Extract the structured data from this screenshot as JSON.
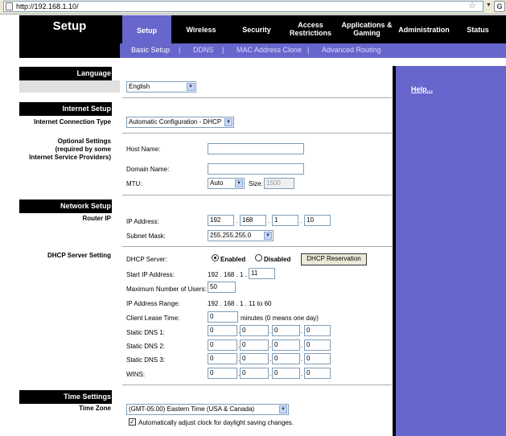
{
  "browser": {
    "url": "http://192.168.1.10/"
  },
  "header": {
    "title": "Setup",
    "tabs": [
      {
        "label": "Setup",
        "active": true
      },
      {
        "label": "Wireless"
      },
      {
        "label": "Security"
      },
      {
        "label_1": "Access",
        "label_2": "Restrictions"
      },
      {
        "label_1": "Applications &",
        "label_2": "Gaming"
      },
      {
        "label": "Administration"
      },
      {
        "label": "Status"
      }
    ],
    "subtabs": [
      "Basic Setup",
      "DDNS",
      "MAC Address Clone",
      "Advanced Routing"
    ]
  },
  "colors": {
    "nav_bg": "#000000",
    "accent": "#6666cc",
    "sub_text": "#dcdcff"
  },
  "sidebar": {
    "language": "Language",
    "internet_setup": "Internet Setup",
    "connection_type": "Internet Connection Type",
    "optional_1": "Optional Settings",
    "optional_2": "(required by some",
    "optional_3": "Internet Service Providers)",
    "network_setup": "Network Setup",
    "router_ip": "Router IP",
    "dhcp_server_setting": "DHCP Server Setting",
    "time_settings": "Time Settings",
    "time_zone": "Time Zone"
  },
  "form": {
    "language": "English",
    "connection_type": "Automatic Configuration - DHCP",
    "host_name_label": "Host Name:",
    "host_name": "",
    "domain_name_label": "Domain Name:",
    "domain_name": "",
    "mtu_label": "MTU:",
    "mtu_mode": "Auto",
    "size_label": "Size:",
    "mtu_size": "1500",
    "ip_label": "IP Address:",
    "ip": [
      "192",
      "168",
      "1",
      "10"
    ],
    "subnet_label": "Subnet Mask:",
    "subnet": "255.255.255.0",
    "dhcp_server_label": "DHCP Server:",
    "enabled_label": "Enabled",
    "disabled_label": "Disabled",
    "dhcp_reservation": "DHCP Reservation",
    "start_ip_label": "Start IP Address:",
    "start_ip_prefix": "192 . 168 . 1 .",
    "start_ip_last": "11",
    "max_users_label": "Maximum Number of Users:",
    "max_users": "50",
    "ip_range_label": "IP Address Range:",
    "ip_range": "192 . 168 . 1 . 11 to 60",
    "lease_label": "Client Lease Time:",
    "lease_value": "0",
    "lease_suffix": "minutes (0 means one day)",
    "dns1_label": "Static DNS 1:",
    "dns2_label": "Static DNS 2:",
    "dns3_label": "Static DNS 3:",
    "wins_label": "WINS:",
    "dns1": [
      "0",
      "0",
      "0",
      "0"
    ],
    "dns2": [
      "0",
      "0",
      "0",
      "0"
    ],
    "dns3": [
      "0",
      "0",
      "0",
      "0"
    ],
    "wins": [
      "0",
      "0",
      "0",
      "0"
    ],
    "timezone": "(GMT-05:00) Eastern Time (USA & Canada)",
    "dst_label": "Automatically adjust clock for daylight saving changes.",
    "dst_checked": "✓"
  },
  "help": {
    "link": "Help..."
  }
}
